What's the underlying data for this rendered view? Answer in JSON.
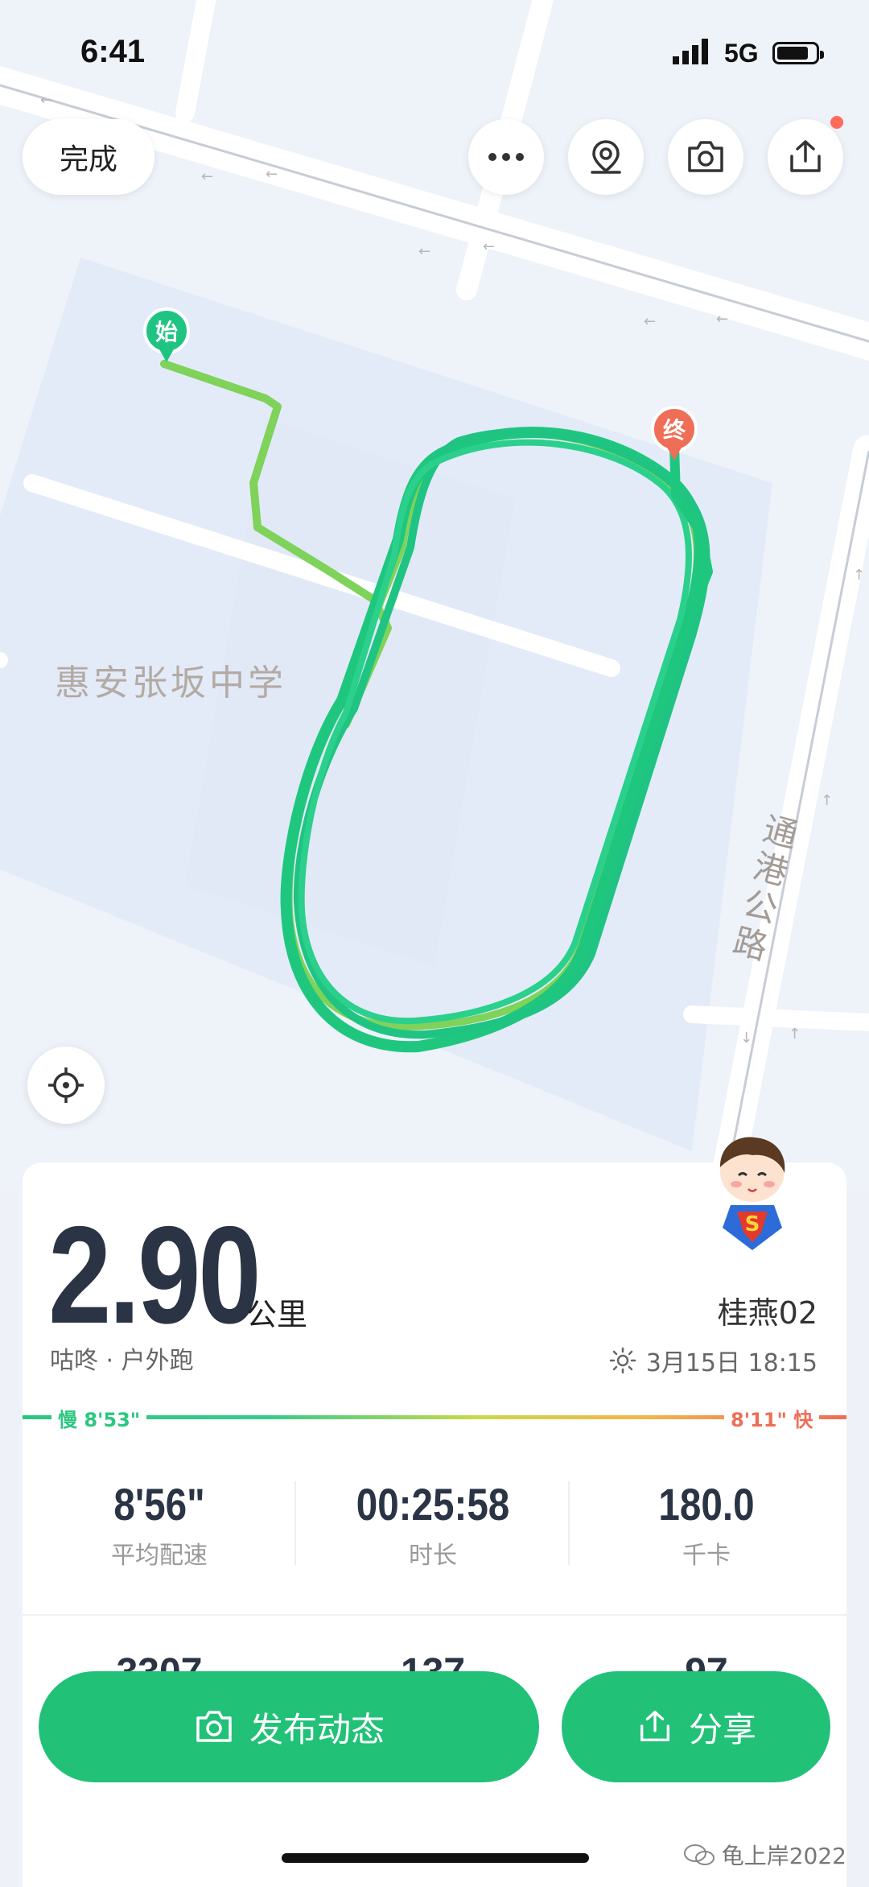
{
  "status_bar": {
    "time": "6:41",
    "network": "5G"
  },
  "top_bar": {
    "done_label": "完成",
    "icons": [
      "more-icon",
      "location-pin-icon",
      "camera-icon",
      "share-icon"
    ]
  },
  "map": {
    "poi_label": "惠安张坂中学",
    "road_label": "通港公路",
    "start_marker": "始",
    "end_marker": "终",
    "route_color": "#1fc77e"
  },
  "summary": {
    "distance": "2.90",
    "distance_unit": "公里",
    "app_type": "咕咚 · 户外跑",
    "user_name": "桂燕02",
    "date_time": "3月15日 18:15"
  },
  "pace_bar": {
    "slow_label": "慢 8'53\"",
    "fast_label": "8'11\" 快"
  },
  "stats": [
    {
      "value": "8'56\"",
      "label": "平均配速"
    },
    {
      "value": "00:25:58",
      "label": "时长"
    },
    {
      "value": "180.0",
      "label": "千卡"
    }
  ],
  "stats_row2_partial": [
    "3307",
    "137",
    "97"
  ],
  "actions": {
    "post_label": "发布动态",
    "share_label": "分享"
  },
  "watermark": "龟上岸2022",
  "colors": {
    "accent": "#21c178",
    "slow": "#2bc77f",
    "fast": "#ee6e57",
    "text_dark": "#2a3445"
  }
}
